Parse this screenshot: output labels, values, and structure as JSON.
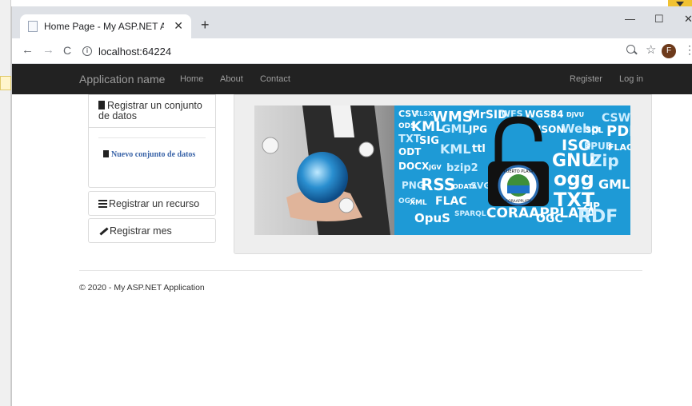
{
  "browser": {
    "tab_title": "Home Page - My ASP.NET Applic",
    "url": "localhost:64224",
    "profile_initial": "F"
  },
  "site": {
    "brand": "Application name",
    "nav_left": [
      "Home",
      "About",
      "Contact"
    ],
    "nav_right": [
      "Register",
      "Log in"
    ]
  },
  "sidebar": {
    "registrar_conjunto": "Registrar un conjunto de datos",
    "nuevo_conjunto": "Nuevo conjunto de datos",
    "registrar_recurso": "Registrar un recurso",
    "registrar_mes": "Registrar mes"
  },
  "hero": {
    "format_words": [
      "CSV",
      "XLSX",
      "WMS",
      "MrSID",
      "WFS",
      "WGS84",
      "DjVU",
      "CSW",
      "ODS",
      "KML",
      "GML",
      "JPG",
      "JSON",
      "Webp",
      "SQL",
      "PDF",
      "TXT",
      "SIG",
      "ISO",
      "EPUB",
      "FLAC",
      "ODT",
      "KML",
      "ttl",
      "GNU",
      "Zip",
      "DOCX",
      "JGV",
      "bzip2",
      "ogg",
      "GML",
      "PNG",
      "RSS",
      "ODATA",
      "SVG",
      "TXT",
      "ZIP",
      "OGC",
      "XML",
      "FLAC",
      "SPARQL",
      "CORAAPPLATA",
      "OGC",
      "RDF",
      "OpuS"
    ],
    "seal_text": "PUERTO PLATA",
    "seal_bottom": "CORAAPPLATA"
  },
  "footer": {
    "text": "© 2020 - My ASP.NET Application"
  },
  "colors": {
    "navbar": "#222222",
    "nav_text": "#9d9d9d",
    "link": "#3a64a8",
    "hero_blue": "#1e9ad6"
  }
}
